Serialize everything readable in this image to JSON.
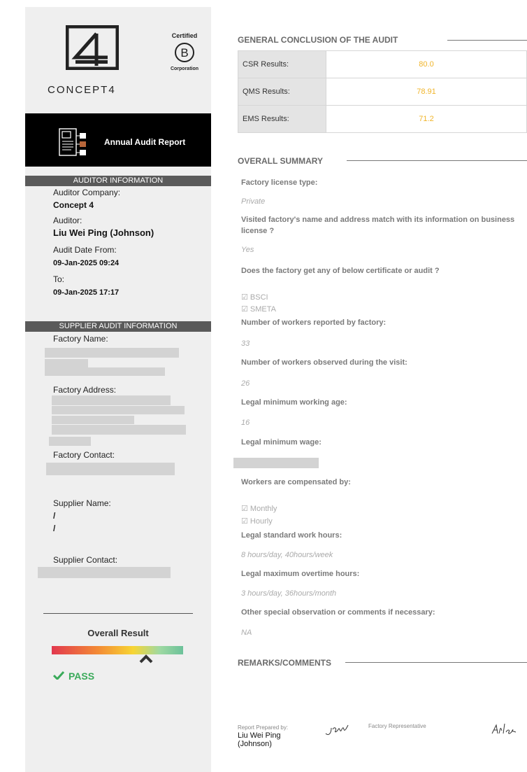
{
  "sidebar": {
    "logo": {
      "wordmark": "CONCEPT4",
      "brand_color": "#222222"
    },
    "bcorp": {
      "top": "Certified",
      "letter": "B",
      "bottom": "Corporation"
    },
    "report_title": "Annual Audit Report",
    "auditor_section": {
      "heading": "AUDITOR INFORMATION",
      "company_label": "Auditor Company:",
      "company_value": "Concept 4",
      "auditor_label": "Auditor:",
      "auditor_value": "Liu Wei Ping (Johnson)",
      "date_from_label": "Audit Date From:",
      "date_from_value": "09-Jan-2025 09:24",
      "date_to_label": "To:",
      "date_to_value": "09-Jan-2025 17:17"
    },
    "supplier_section": {
      "heading": "SUPPLIER AUDIT INFORMATION",
      "factory_name_label": "Factory Name:",
      "factory_address_label": "Factory Address:",
      "factory_contact_label": "Factory Contact:",
      "supplier_name_label": "Supplier Name:",
      "supplier_name_line1": "/",
      "supplier_name_line2": "/",
      "supplier_contact_label": "Supplier Contact:"
    },
    "overall": {
      "label": "Overall Result",
      "marker_position_fraction": 0.72,
      "result_text": "PASS",
      "result_color": "#3aaa5a"
    }
  },
  "main": {
    "conclusion_heading": "GENERAL CONCLUSION OF THE AUDIT",
    "results": [
      {
        "label": "CSR Results:",
        "value": "80.0"
      },
      {
        "label": "QMS Results:",
        "value": "78.91"
      },
      {
        "label": "EMS Results:",
        "value": "71.2"
      }
    ],
    "value_color": "#f0b429",
    "summary_heading": "OVERALL SUMMARY",
    "summary": {
      "q_license": "Factory license type:",
      "a_license": "Private",
      "q_match": "Visited factory's name and address match with its information on business license ?",
      "a_match": "Yes",
      "q_cert": "Does the factory get any of below certificate or audit ?",
      "cert_1": "☑ BSCI",
      "cert_2": "☑ SMETA",
      "q_workers_reported": "Number of workers reported by factory:",
      "a_workers_reported": "33",
      "q_workers_observed": "Number of workers observed during the visit:",
      "a_workers_observed": "26",
      "q_min_age": "Legal minimum working age:",
      "a_min_age": "16",
      "q_min_wage": "Legal minimum wage:",
      "q_compensated": "Workers are compensated by:",
      "comp_1": "☑ Monthly",
      "comp_2": "☑ Hourly",
      "q_std_hours": "Legal standard work hours:",
      "a_std_hours": "8 hours/day, 40hours/week",
      "q_max_ot": "Legal maximum overtime hours:",
      "a_max_ot": "3 hours/day, 36hours/month",
      "q_other": "Other special observation or comments if necessary:",
      "a_other": "NA"
    },
    "remarks_heading": "REMARKS/COMMENTS",
    "signatures": {
      "prepared_label": "Report Prepared by:",
      "prepared_name_1": "Liu Wei Ping",
      "prepared_name_2": "(Johnson)",
      "factory_rep_label": "Factory Representative"
    }
  }
}
